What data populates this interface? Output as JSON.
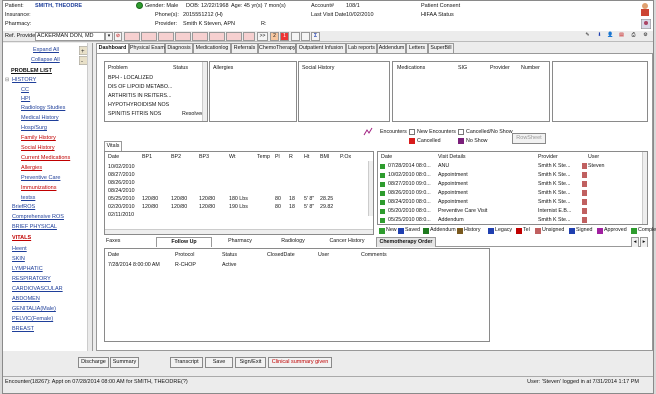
{
  "header": {
    "patient_label": "Patient:",
    "patient_name": "SMITH, THEODRE",
    "insurance_label": "Insurance:",
    "pharmacy_label": "Pharmacy:",
    "gender": "Gender: Male",
    "dob": "DOB: 12/22/1968",
    "age": "Age: 45 yr(s) 7 mon(s)",
    "account": "Account#",
    "account_no": "108/1",
    "patient_consent": "Patient Consent",
    "phone_label": "Phone(s):",
    "phone": "2015551212 (H)",
    "last_visit_label": "Last Visit Date",
    "last_visit": "10/02/2010",
    "hipaa": "HIFAA Status",
    "provider_label": "Provider:",
    "provider": "Smith K Steven, APN",
    "r_label": "R:"
  },
  "toolbar": {
    "ref_provider_label": "Ref. Provider:",
    "ref_provider": "ACKERMAN DON, MD",
    "nav_next": ">>",
    "badge_2": "2",
    "badge_1": "1"
  },
  "left_panel": {
    "expand": "Expand All",
    "collapse": "Collapse All",
    "problem_list": "PROBLEM LIST",
    "history": "HISTORY",
    "items_blue": [
      "CC",
      "HPI",
      "Radiology Studies",
      "Medical History",
      "Hosp/Surg"
    ],
    "items_red": [
      "Family History",
      "Social History",
      "Current Medications",
      "Allergies"
    ],
    "items_blue2": [
      "Preventive Care"
    ],
    "items_red2": [
      "Immunizations"
    ],
    "items_blue3": [
      "testss"
    ],
    "sections": [
      "BriefROS",
      "Comprehensive ROS",
      "BRIEF PHYSICAL",
      "VITALS",
      "Heent",
      "SKIN",
      "LYMPHATIC",
      "RESPIRATORY",
      "CARDIOVASCULAR",
      "ABDOMEN",
      "GENITALIA(Male)",
      "PELVIC(Female)",
      "BREAST"
    ]
  },
  "tabs": [
    "Dashboard",
    "Physical Exam",
    "Diagnosis",
    "Medicationlog",
    "Referrals",
    "ChemoTherapy",
    "Outpatient Infusion",
    "Lab reports",
    "Addendum",
    "Letters",
    "SuperBill"
  ],
  "problems": {
    "col_problem": "Problem",
    "col_status": "Status",
    "rows": [
      "BPH - LOCALIZED",
      "DIS OF LIPOID METABO...",
      "ARTHRITIS IN REITERS...",
      "HYPOTHYROIDISM NOS",
      "SPINITIS FITRIS NOS"
    ],
    "last_status": "Resolved"
  },
  "panels": {
    "allergies": "Allergies",
    "social_history": "Social History",
    "medications": "Medications",
    "sig": "SIG",
    "provider": "Provider",
    "number": "Number"
  },
  "encounters_filter": {
    "label": "Encounters",
    "new": "New Encounters",
    "cancelled_noshow": "Cancelled/No Show",
    "cancelled": "Cancelled",
    "no_show": "No Show",
    "row_sheet": "RowSheet"
  },
  "vitals": {
    "tab": "Vitals",
    "headers": [
      "Date",
      "BP1",
      "BP2",
      "BP3",
      "Wt",
      "Temp",
      "Pl",
      "R",
      "Ht",
      "BMI",
      "P.Ox"
    ],
    "rows": [
      [
        "10/02/2010",
        "",
        "",
        "",
        "",
        "",
        "",
        "",
        "",
        "",
        ""
      ],
      [
        "08/27/2010",
        "",
        "",
        "",
        "",
        "",
        "",
        "",
        "",
        "",
        ""
      ],
      [
        "08/26/2010",
        "",
        "",
        "",
        "",
        "",
        "",
        "",
        "",
        "",
        ""
      ],
      [
        "08/24/2010",
        "",
        "",
        "",
        "",
        "",
        "",
        "",
        "",
        "",
        ""
      ],
      [
        "05/25/2010",
        "120/80",
        "120/80",
        "120/80",
        "180 Lbs",
        "",
        "80",
        "18",
        "5' 8\"",
        "28.25",
        ""
      ],
      [
        "02/20/2010",
        "120/80",
        "120/80",
        "120/80",
        "190 Lbs",
        "",
        "80",
        "18",
        "5' 8\"",
        "29.82",
        ""
      ],
      [
        "02/11/2010",
        "",
        "",
        "",
        "",
        "",
        "",
        "",
        "",
        "",
        ""
      ]
    ]
  },
  "encounters": {
    "headers": [
      "Date",
      "Visit Details",
      "Provider",
      "User"
    ],
    "rows": [
      [
        "07/28/2014 08:0...",
        "ANU",
        "Smith K Ste...",
        "Steven"
      ],
      [
        "10/02/2010 08:0...",
        "Appointment",
        "Smith K Ste...",
        ""
      ],
      [
        "08/27/2010 09:0...",
        "Appointment",
        "Smith K Ste...",
        ""
      ],
      [
        "08/26/2010 09:0...",
        "Appointment",
        "Smith K Ste...",
        ""
      ],
      [
        "08/24/2010 08:0...",
        "Appointment",
        "Smith K Ste...",
        ""
      ],
      [
        "05/20/2010 08:0...",
        "Preventive Care Visit",
        "Internist E.B...",
        ""
      ],
      [
        "05/25/2010 08:0...",
        "Addendum",
        "Smith K Ste...",
        ""
      ]
    ],
    "legend": [
      "New",
      "Saved",
      "Addendum",
      "History",
      "Legacy",
      "Tel",
      "Unsigned",
      "Signed",
      "Approved",
      "Complet"
    ]
  },
  "bottom_tabs": [
    "Faxes",
    "Follow Up",
    "Pharmacy",
    "Radiology",
    "Cancer History",
    "Chemotherapy Order"
  ],
  "chemo": {
    "headers": [
      "Date",
      "Protocol",
      "Status",
      "ClosedDate",
      "User",
      "Comments"
    ],
    "rows": [
      [
        "7/28/2014 8:00:00 AM",
        "R-CHOP",
        "Active",
        "",
        "",
        ""
      ]
    ]
  },
  "footer_buttons": {
    "discharge": "Discharge",
    "summary": "Summary",
    "transcript": "Transcript",
    "save": "Save",
    "sign_exit": "Sign/Exit",
    "clinical_summary": "Clinical summary given"
  },
  "status_bar": {
    "left": "Encounter(18267): Appt on 07/28/2014 08:00 AM for SMITH, THEODRE(?)",
    "right": "User: 'Steven' logged in at 7/31/2014 1:17 PM"
  },
  "colors": {
    "accent_red": "#c00000",
    "link_blue": "#1f3f9a",
    "cancelled": "#d81b1b",
    "no_show": "#7a1f7a"
  }
}
